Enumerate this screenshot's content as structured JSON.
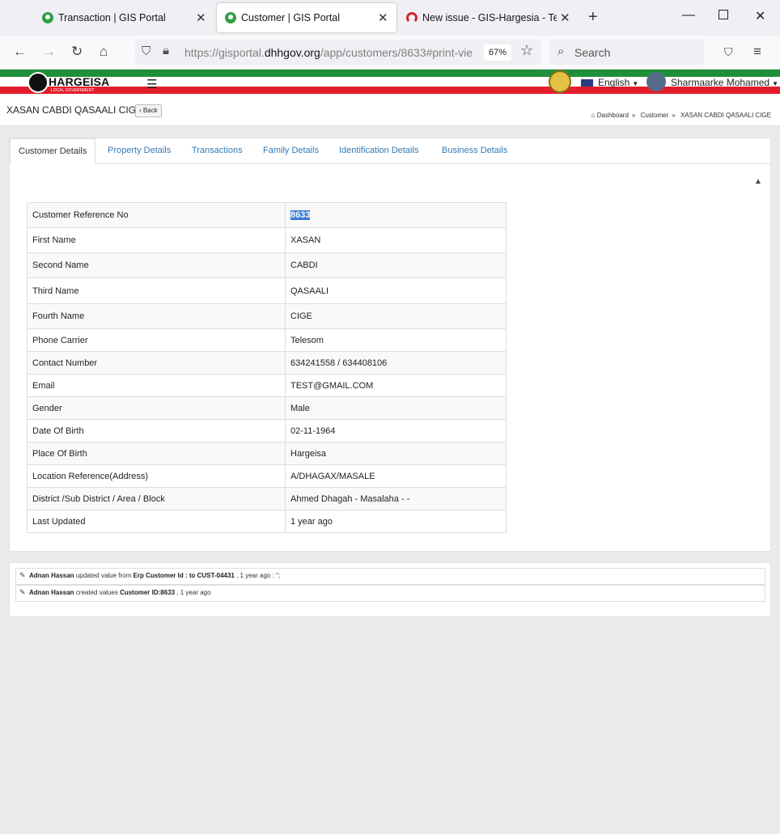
{
  "browser": {
    "tabs": [
      {
        "title": "Transaction | GIS Portal",
        "active": false
      },
      {
        "title": "Customer | GIS Portal",
        "active": true
      },
      {
        "title": "New issue - GIS-Hargesia - Team",
        "active": false
      }
    ],
    "url_prefix": "https://gisportal.",
    "url_domain": "dhhgov.org",
    "url_path": "/app/customers/8633#print-vie",
    "zoom": "67%",
    "search_placeholder": "Search"
  },
  "site": {
    "logo_text": "HARGEISA",
    "logo_subtext": "LOCAL GOVERNMENT",
    "language": "English",
    "user_name": "Sharmaarke Mohamed"
  },
  "page": {
    "title": "XASAN CABDI QASAALI CIGE",
    "back_label": "Back",
    "breadcrumb": [
      "Dashboard",
      "Customer",
      "XASAN CABDI QASAALI CIGE"
    ]
  },
  "tabs": [
    "Customer Details",
    "Property Details",
    "Transactions",
    "Family Details",
    "Identification Details",
    "Business Details"
  ],
  "details": [
    {
      "label": "Customer Reference No",
      "value": "8633"
    },
    {
      "label": "First Name",
      "value": "XASAN"
    },
    {
      "label": "Second Name",
      "value": "CABDI"
    },
    {
      "label": "Third Name",
      "value": "QASAALI"
    },
    {
      "label": "Fourth Name",
      "value": "CIGE"
    },
    {
      "label": "Phone Carrier",
      "value": "Telesom"
    },
    {
      "label": "Contact Number",
      "value": "634241558 / 634408106"
    },
    {
      "label": "Email",
      "value": "TEST@GMAIL.COM"
    },
    {
      "label": "Gender",
      "value": "Male"
    },
    {
      "label": "Date Of Birth",
      "value": "02-11-1964"
    },
    {
      "label": "Place Of Birth",
      "value": "Hargeisa"
    },
    {
      "label": "Location Reference(Address)",
      "value": "A/DHAGAX/MASALE"
    },
    {
      "label": "District /Sub District / Area / Block",
      "value": "Ahmed Dhagah - Masalaha - -"
    },
    {
      "label": "Last Updated",
      "value": "1 year ago"
    }
  ],
  "log": [
    {
      "user": "Adnan Hassan",
      "action": " updated value from ",
      "detail": "Erp Customer Id : to CUST-04431",
      "suffix": " , 1 year ago : '';"
    },
    {
      "user": "Adnan Hassan",
      "action": " created values ",
      "detail": "Customer ID:8633",
      "suffix": " , 1 year ago"
    }
  ]
}
